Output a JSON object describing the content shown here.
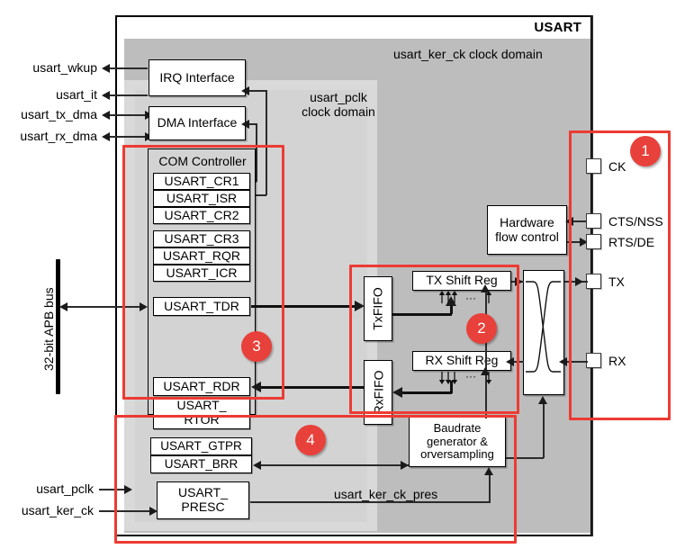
{
  "diagram": {
    "title": "USART",
    "domains": {
      "ker_ck_label": "usart_ker_ck  clock domain",
      "pclk_label_line1": "usart_pclk",
      "pclk_label_line2": "clock domain"
    },
    "external_signals_left": [
      {
        "name": "usart_wkup"
      },
      {
        "name": "usart_it"
      },
      {
        "name": "usart_tx_dma"
      },
      {
        "name": "usart_rx_dma"
      }
    ],
    "bus": {
      "label": "32-bit APB bus"
    },
    "clock_inputs": [
      {
        "name": "usart_pclk"
      },
      {
        "name": "usart_ker_ck"
      }
    ],
    "interfaces": [
      {
        "label": "IRQ Interface"
      },
      {
        "label": "DMA Interface"
      }
    ],
    "com_controller": {
      "title": "COM Controller",
      "group1": [
        "USART_CR1",
        "USART_ISR",
        "USART_CR2"
      ],
      "group2": [
        "USART_CR3",
        "USART_RQR",
        "USART_ICR"
      ],
      "tdr": "USART_TDR",
      "rdr": "USART_RDR",
      "rtor_line1": "USART_",
      "rtor_line2": "RTOR",
      "gtpr": "USART_GTPR",
      "brr": "USART_BRR",
      "presc_line1": "USART_",
      "presc_line2": "PRESC"
    },
    "datapath": {
      "tx_fifo": "TxFIFO",
      "rx_fifo": "RxFIFO",
      "tx_shift_reg": "TX Shift Reg",
      "rx_shift_reg": "RX Shift Reg",
      "shift_dots": "...",
      "hardware_flow_control_line1": "Hardware",
      "hardware_flow_control_line2": "flow control",
      "baudrate_line1": "Baudrate",
      "baudrate_line2": "generator &",
      "baudrate_line3": "orversampling",
      "ker_ck_pres_label": "usart_ker_ck_pres"
    },
    "pins": [
      {
        "name": "CK"
      },
      {
        "name": "CTS/NSS"
      },
      {
        "name": "RTS/DE"
      },
      {
        "name": "TX"
      },
      {
        "name": "RX"
      }
    ],
    "callouts": [
      {
        "id": "1",
        "number": "1"
      },
      {
        "id": "2",
        "number": "2"
      },
      {
        "id": "3",
        "number": "3"
      },
      {
        "id": "4",
        "number": "4"
      }
    ],
    "colors": {
      "callout_red": "#ec3b33",
      "badge_red": "#e8403a",
      "ker_domain_gray": "#bdbdbd",
      "pclk_domain_gray": "#d9d9d9",
      "block_fill": "#ffffff"
    }
  }
}
